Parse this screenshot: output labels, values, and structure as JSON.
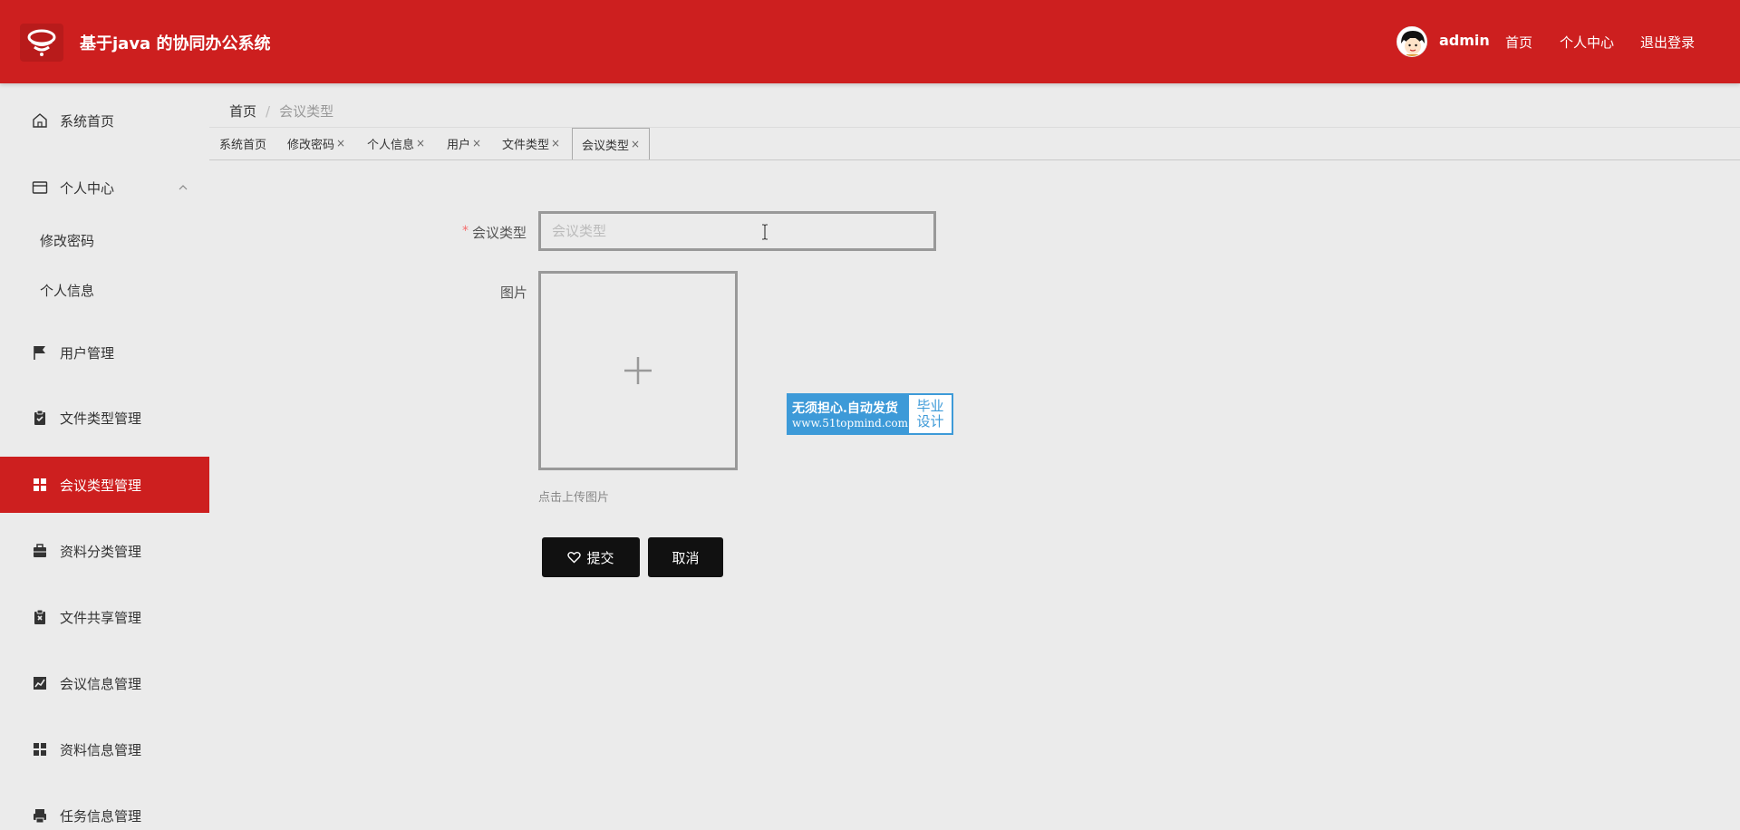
{
  "header": {
    "title": "基于java 的协同办公系统",
    "username": "admin",
    "links": [
      "首页",
      "个人中心",
      "退出登录"
    ]
  },
  "sidebar": {
    "items": [
      {
        "label": "系统首页",
        "icon": "home-icon"
      },
      {
        "label": "个人中心",
        "icon": "card-icon"
      },
      {
        "label": "修改密码"
      },
      {
        "label": "个人信息"
      },
      {
        "label": "用户管理",
        "icon": "flag-icon"
      },
      {
        "label": "文件类型管理",
        "icon": "clipboard-icon"
      },
      {
        "label": "会议类型管理",
        "icon": "grid-icon",
        "active": true
      },
      {
        "label": "资料分类管理",
        "icon": "briefcase-icon"
      },
      {
        "label": "文件共享管理",
        "icon": "document-x-icon"
      },
      {
        "label": "会议信息管理",
        "icon": "chart-icon"
      },
      {
        "label": "资料信息管理",
        "icon": "grid-icon"
      },
      {
        "label": "任务信息管理",
        "icon": "printer-icon"
      }
    ]
  },
  "breadcrumb": {
    "home": "首页",
    "separator": "/",
    "current": "会议类型"
  },
  "tabs": [
    {
      "label": "系统首页"
    },
    {
      "label": "修改密码",
      "close": "×"
    },
    {
      "label": "个人信息",
      "close": "×"
    },
    {
      "label": "用户",
      "close": "×"
    },
    {
      "label": "文件类型",
      "close": "×"
    },
    {
      "label": "会议类型",
      "close": "×",
      "active": true
    }
  ],
  "form": {
    "required_mark": "*",
    "type_label": "会议类型",
    "type_placeholder": "会议类型",
    "image_label": "图片",
    "upload_hint": "点击上传图片",
    "submit_label": "提交",
    "cancel_label": "取消"
  },
  "badge": {
    "line1": "无须担心.自动发货",
    "line2": "www.51topmind.com",
    "right1": "毕业",
    "right2": "设计"
  },
  "colors": {
    "brand": "#cd1f1f",
    "button": "#111111",
    "badge": "#3d9ad8"
  }
}
